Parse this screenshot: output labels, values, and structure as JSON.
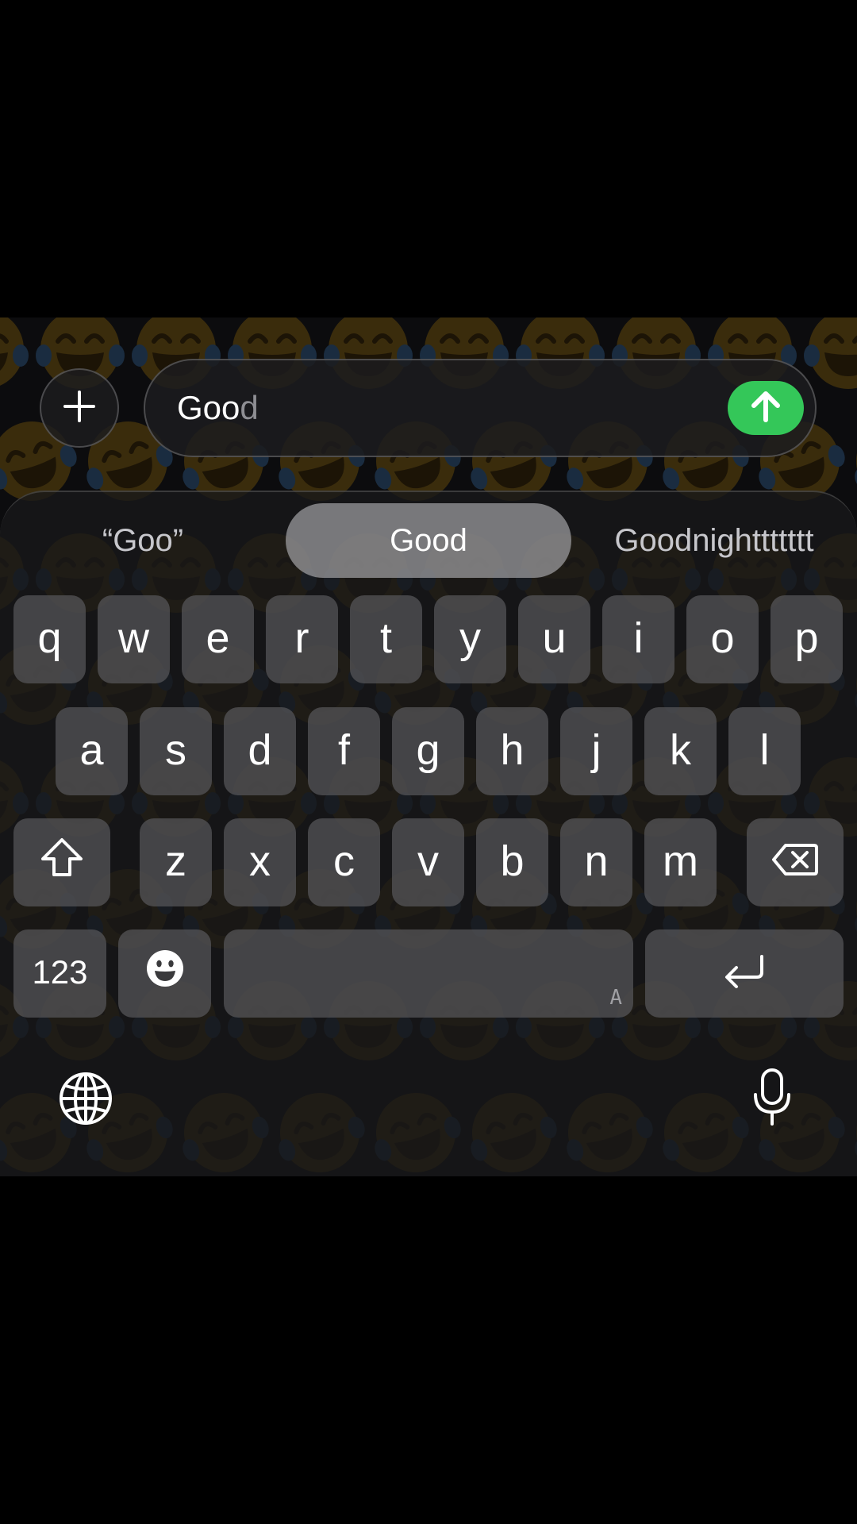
{
  "compose": {
    "typed_text": "Goo",
    "autocomplete_text": "d"
  },
  "suggestions": [
    {
      "label": "“Goo”",
      "selected": false
    },
    {
      "label": "Good",
      "selected": true
    },
    {
      "label": "Goodnighttttttt",
      "selected": false
    }
  ],
  "keys": {
    "row1": [
      "q",
      "w",
      "e",
      "r",
      "t",
      "y",
      "u",
      "i",
      "o",
      "p"
    ],
    "row2": [
      "a",
      "s",
      "d",
      "f",
      "g",
      "h",
      "j",
      "k",
      "l"
    ],
    "row3": [
      "z",
      "x",
      "c",
      "v",
      "b",
      "n",
      "m"
    ],
    "numbers_label": "123",
    "space_hint": "A"
  },
  "icons": {
    "plus": "plus-icon",
    "send": "arrow-up-icon",
    "shift": "shift-icon",
    "delete": "delete-icon",
    "emoji": "emoji-icon",
    "return": "return-icon",
    "globe": "globe-icon",
    "mic": "microphone-icon",
    "wallpaper": "rolling-laughing-emoji"
  },
  "colors": {
    "send_button": "#34c759",
    "key_fill": "#58585a",
    "selected_suggestion": "#a0a0a2"
  }
}
